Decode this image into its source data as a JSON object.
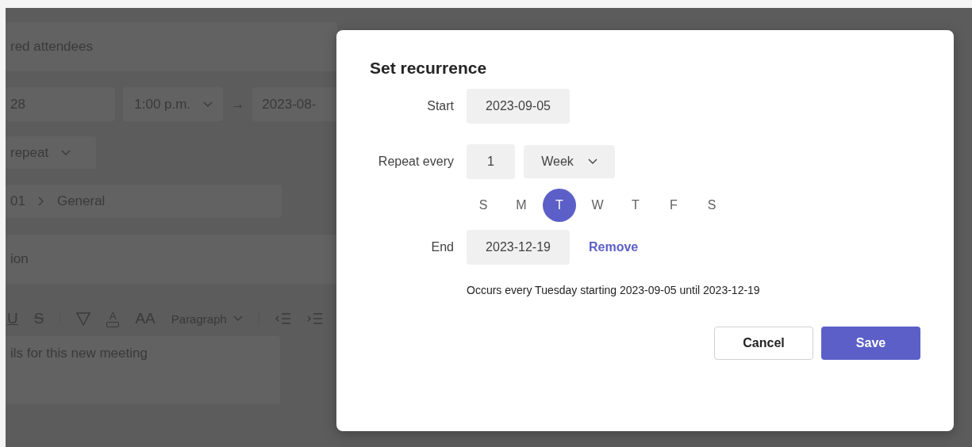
{
  "background_form": {
    "attendees_field": {
      "value": "red attendees"
    },
    "start_date": {
      "value": "28"
    },
    "start_time": {
      "value": "1:00 p.m."
    },
    "arrow": "→",
    "end_date": {
      "value": "2023-08-"
    },
    "repeat_dropdown": {
      "value": "repeat"
    },
    "channel_field": {
      "team": "01",
      "channel": "General"
    },
    "location_field": {
      "value": "ion"
    },
    "toolbar": [
      {
        "kind": "underline",
        "glyph": "U"
      },
      {
        "kind": "strikethrough",
        "glyph": "S"
      },
      {
        "kind": "divider"
      },
      {
        "kind": "highlight"
      },
      {
        "kind": "font-color",
        "glyph": "A"
      },
      {
        "kind": "font-size",
        "glyph": "AA"
      },
      {
        "kind": "dropdown",
        "label": "Paragraph"
      },
      {
        "kind": "divider"
      },
      {
        "kind": "outdent"
      },
      {
        "kind": "indent"
      }
    ],
    "details_field": {
      "placeholder": "ils for this new meeting"
    }
  },
  "dialog": {
    "title": "Set recurrence",
    "start": {
      "label": "Start",
      "value": "2023-09-05"
    },
    "repeat": {
      "label": "Repeat every",
      "count": "1",
      "unit": "Week"
    },
    "days": [
      {
        "label": "S",
        "selected": false
      },
      {
        "label": "M",
        "selected": false
      },
      {
        "label": "T",
        "selected": true
      },
      {
        "label": "W",
        "selected": false
      },
      {
        "label": "T",
        "selected": false
      },
      {
        "label": "F",
        "selected": false
      },
      {
        "label": "S",
        "selected": false
      }
    ],
    "end": {
      "label": "End",
      "value": "2023-12-19",
      "link": "Remove"
    },
    "summary": "Occurs every Tuesday starting 2023-09-05 until 2023-12-19",
    "buttons": [
      {
        "label": "Cancel",
        "kind": "secondary"
      },
      {
        "label": "Save",
        "kind": "primary"
      }
    ]
  }
}
